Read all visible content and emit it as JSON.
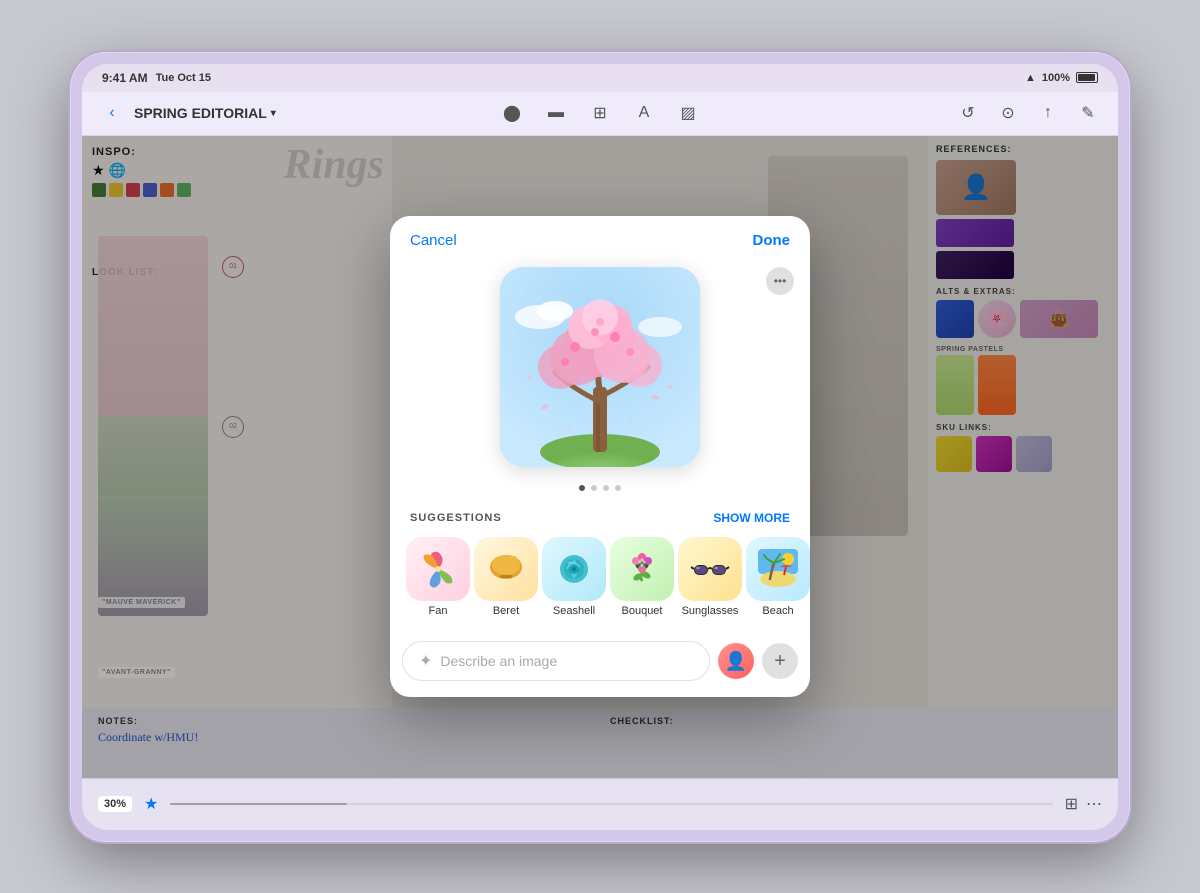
{
  "device": {
    "time": "9:41 AM",
    "date": "Tue Oct 15",
    "battery": "100%",
    "wifi": true
  },
  "toolbar": {
    "back_icon": "‹",
    "title": "SPRING EDITORIAL",
    "chevron": "▾",
    "dots": "•••"
  },
  "modal": {
    "cancel_label": "Cancel",
    "done_label": "Done",
    "more_icon": "•••",
    "dots": [
      "active",
      "inactive",
      "inactive",
      "inactive"
    ],
    "suggestions_label": "SUGGESTIONS",
    "show_more_label": "SHOW MORE",
    "input_placeholder": "Describe an image",
    "items": [
      {
        "id": "fan",
        "label": "Fan",
        "emoji": "🪭"
      },
      {
        "id": "beret",
        "label": "Beret",
        "emoji": "🪃"
      },
      {
        "id": "seashell",
        "label": "Seashell",
        "emoji": "🐚"
      },
      {
        "id": "bouquet",
        "label": "Bouquet",
        "emoji": "💐"
      },
      {
        "id": "sunglasses",
        "label": "Sunglasses",
        "emoji": "🕶️"
      },
      {
        "id": "beach",
        "label": "Beach",
        "emoji": "🏖️"
      }
    ]
  },
  "moodboard": {
    "title": "SPRING EDITORIAL",
    "inspo_label": "INSPO:",
    "look_list_label": "LOOK LIST:",
    "zoom": "30%",
    "notes_label": "NOTES:",
    "checklist_label": "CHECKLIST:",
    "notes_text": "Coordinate w/HMU!",
    "refs_label": "REFERENCES:",
    "alts_label": "ALTS & EXTRAS:",
    "sku_label": "SKU LINKS:",
    "spring_pastels": "SPRING PASTELS"
  }
}
